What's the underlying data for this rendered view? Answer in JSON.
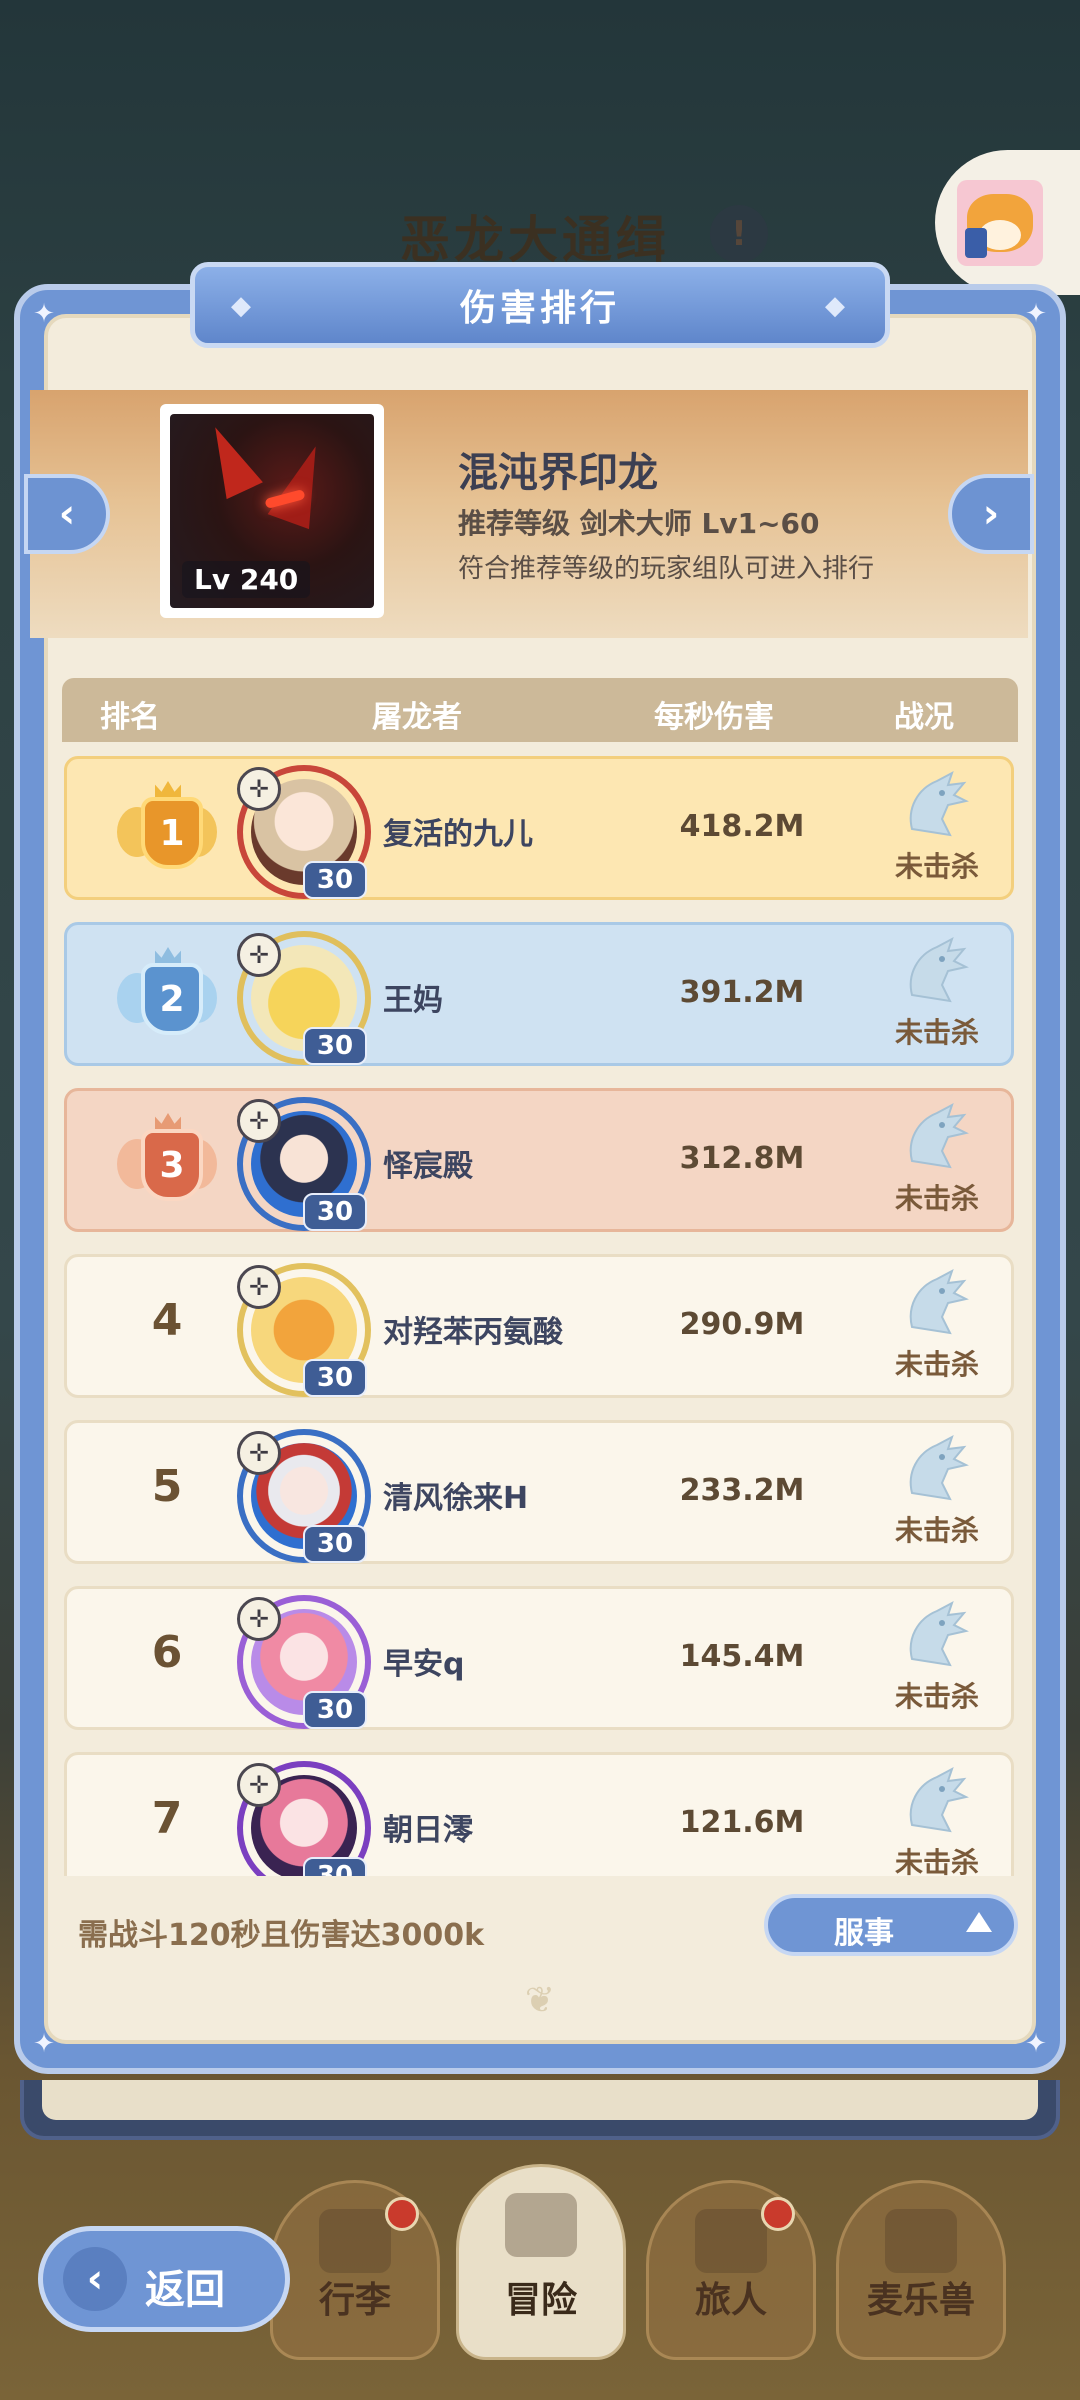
{
  "background": {
    "event_title": "恶龙大通缉",
    "event_badge": "!"
  },
  "panel": {
    "title": "伤害排行",
    "boss": {
      "name": "混沌界印龙",
      "level": "Lv 240",
      "recommend": "推荐等级 剑术大师 Lv1~60",
      "note": "符合推荐等级的玩家组队可进入排行",
      "prev_icon": "‹",
      "next_icon": "›"
    },
    "table": {
      "headers": {
        "rank": "排名",
        "slayer": "屠龙者",
        "dps": "每秒伤害",
        "status": "战况"
      },
      "rows": [
        {
          "rank": "1",
          "name": "复活的九儿",
          "level": "30",
          "damage": "418.2M",
          "status": "未击杀"
        },
        {
          "rank": "2",
          "name": "王妈",
          "level": "30",
          "damage": "391.2M",
          "status": "未击杀"
        },
        {
          "rank": "3",
          "name": "怿宸殿",
          "level": "30",
          "damage": "312.8M",
          "status": "未击杀"
        },
        {
          "rank": "4",
          "name": "对羟苯丙氨酸",
          "level": "30",
          "damage": "290.9M",
          "status": "未击杀"
        },
        {
          "rank": "5",
          "name": "清风徐来H",
          "level": "30",
          "damage": "233.2M",
          "status": "未击杀"
        },
        {
          "rank": "6",
          "name": "早安q",
          "level": "30",
          "damage": "145.4M",
          "status": "未击杀"
        },
        {
          "rank": "7",
          "name": "朝日澪",
          "level": "30",
          "damage": "121.6M",
          "status": "未击杀"
        }
      ]
    },
    "requirement": "需战斗120秒且伤害达3000k",
    "server_button": "服事"
  },
  "nav": {
    "back": "返回",
    "items": [
      "行李",
      "冒险",
      "旅人",
      "麦乐兽"
    ]
  },
  "colors": {
    "panel_blue": "#6f95d4",
    "rank1": "#fde7b2",
    "rank2": "#cfe2f2",
    "rank3": "#f4d6c4",
    "parchment": "#f3ecdc"
  }
}
